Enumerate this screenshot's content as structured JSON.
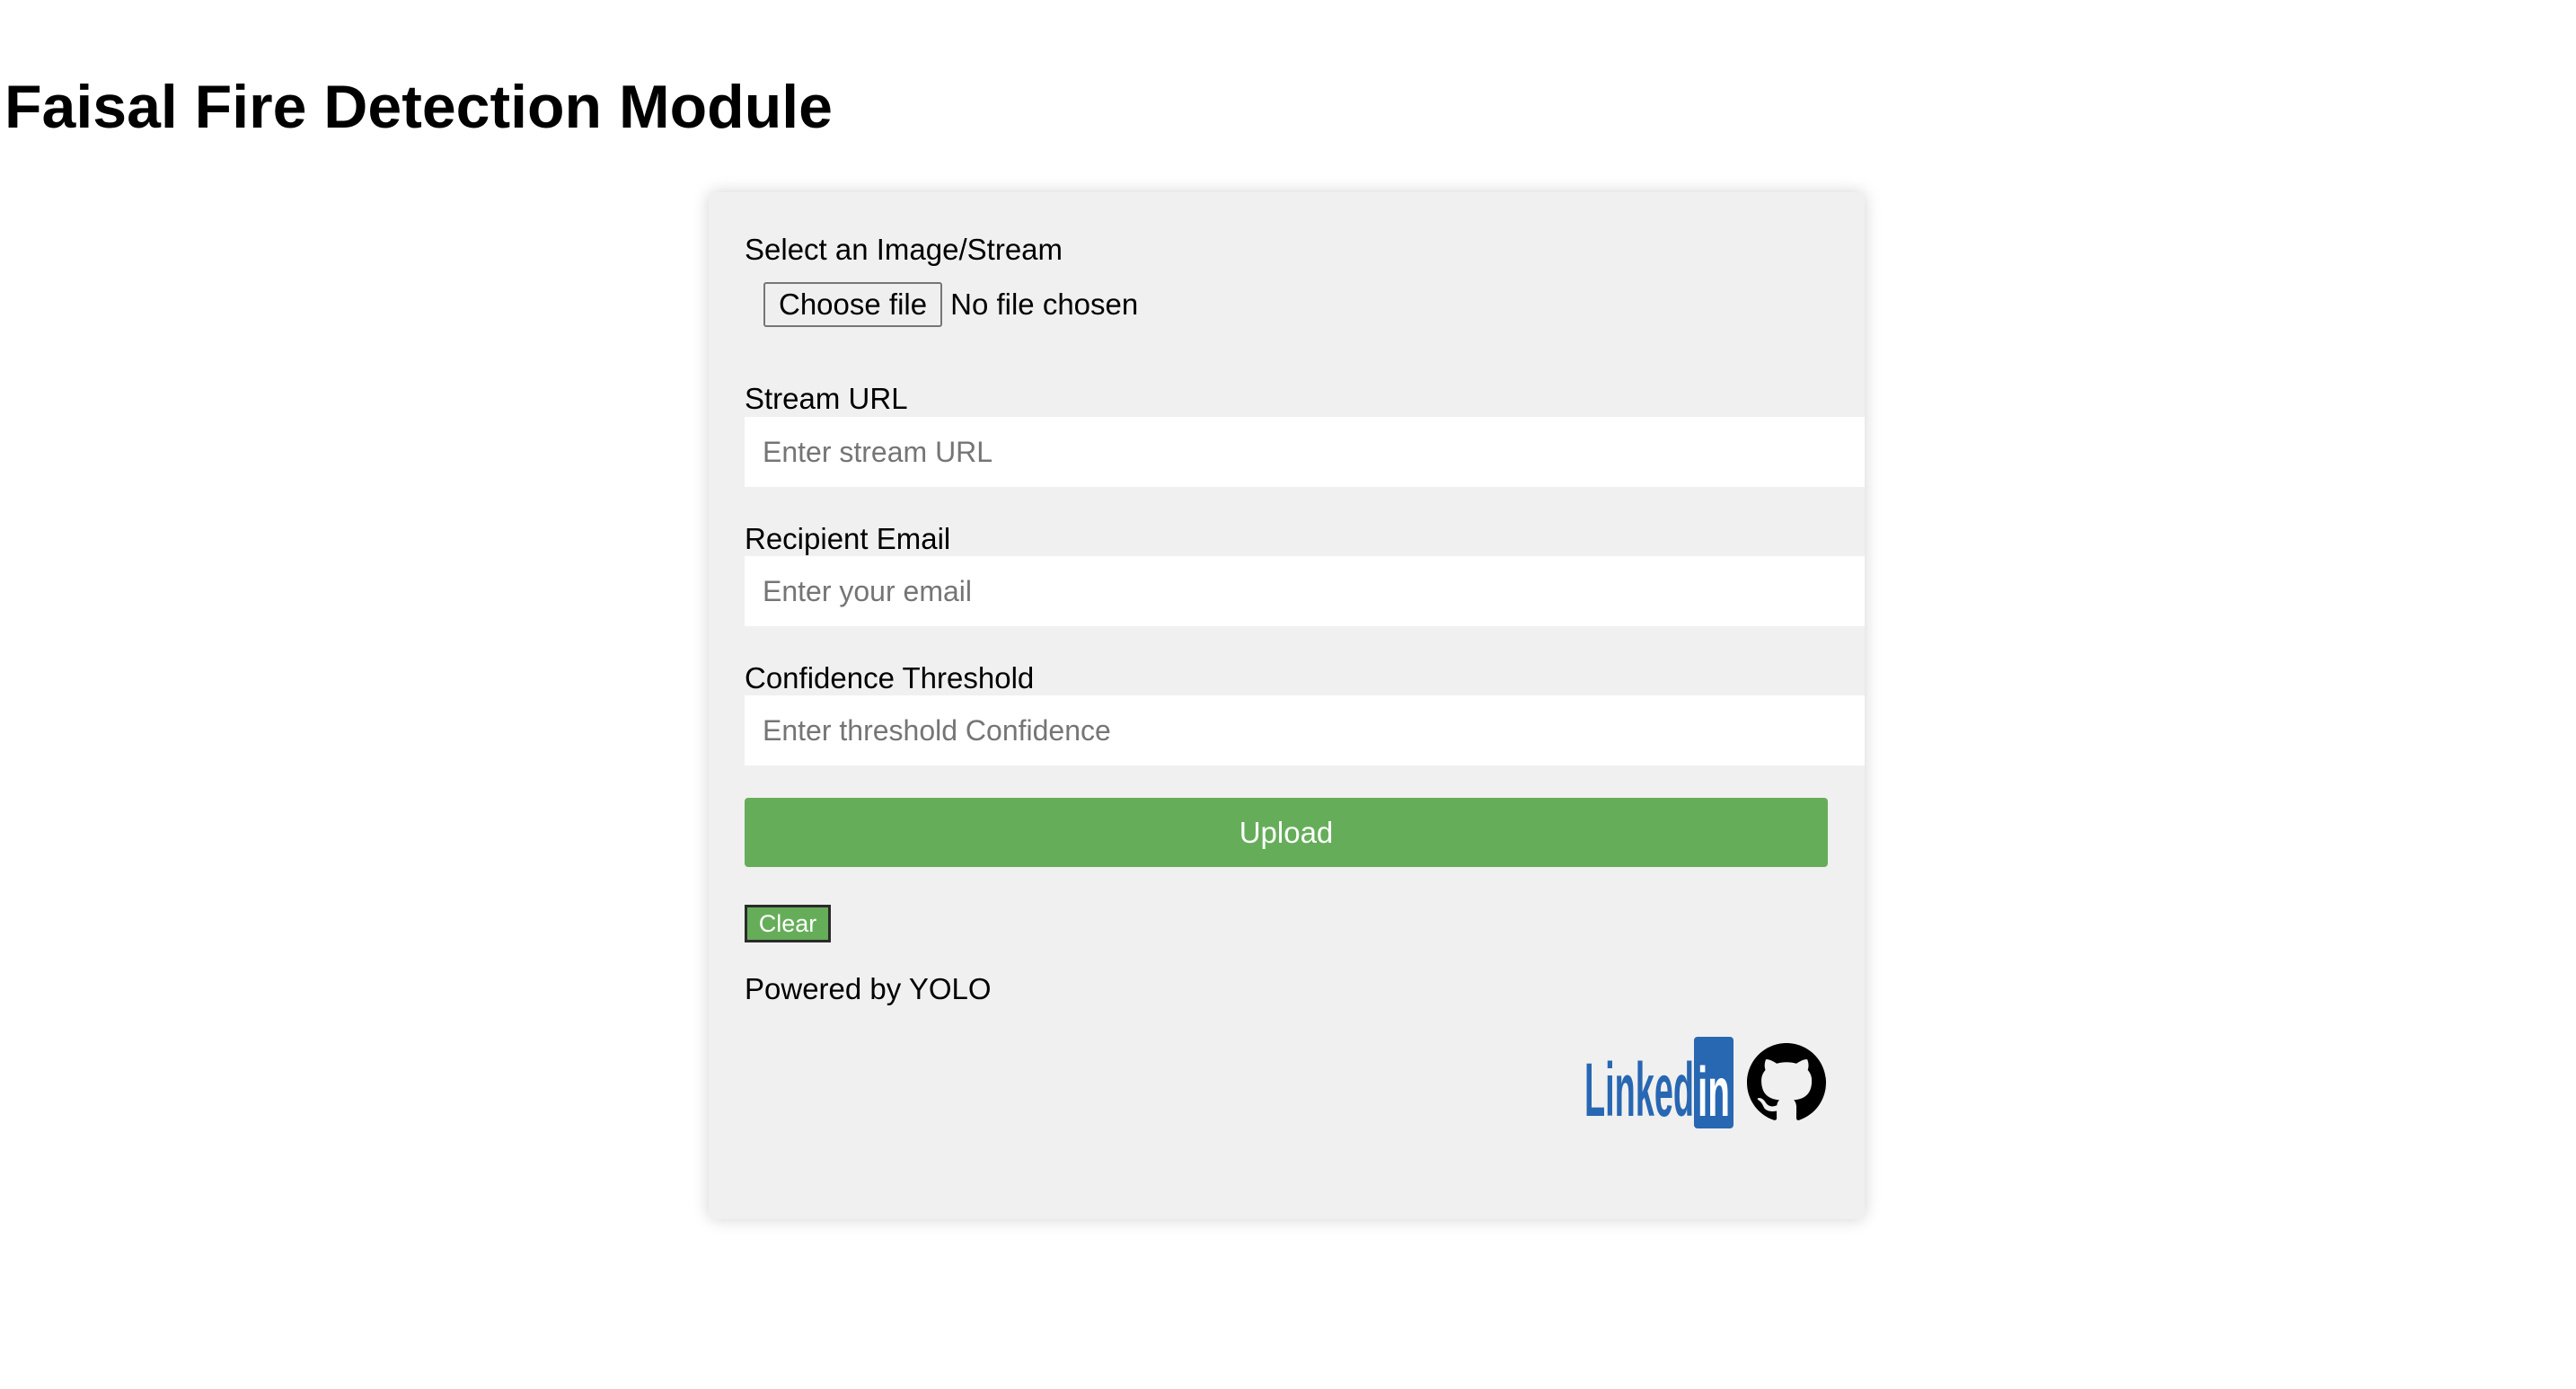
{
  "page": {
    "title": "Faisal Fire Detection Module"
  },
  "form": {
    "file_label": "Select an Image/Stream",
    "choose_file_label": "Choose file",
    "file_status": "No file chosen",
    "stream_url_label": "Stream URL",
    "stream_url_placeholder": "Enter stream URL",
    "stream_url_value": "",
    "email_label": "Recipient Email",
    "email_placeholder": "Enter your email",
    "email_value": "",
    "threshold_label": "Confidence Threshold",
    "threshold_placeholder": "Enter threshold Confidence",
    "threshold_value": "",
    "upload_label": "Upload",
    "clear_label": "Clear",
    "powered_by": "Powered by YOLO"
  },
  "social": {
    "linkedin": {
      "icon": "linkedin-logo-icon",
      "wordmark": "Linked",
      "badge": "in",
      "color": "#2867b2"
    },
    "github": {
      "icon": "github-octocat-icon",
      "color": "#000000"
    }
  },
  "colors": {
    "accent": "#66ad5a",
    "card_background": "#f0f0f0",
    "input_background": "#ffffff",
    "placeholder": "#757575"
  }
}
